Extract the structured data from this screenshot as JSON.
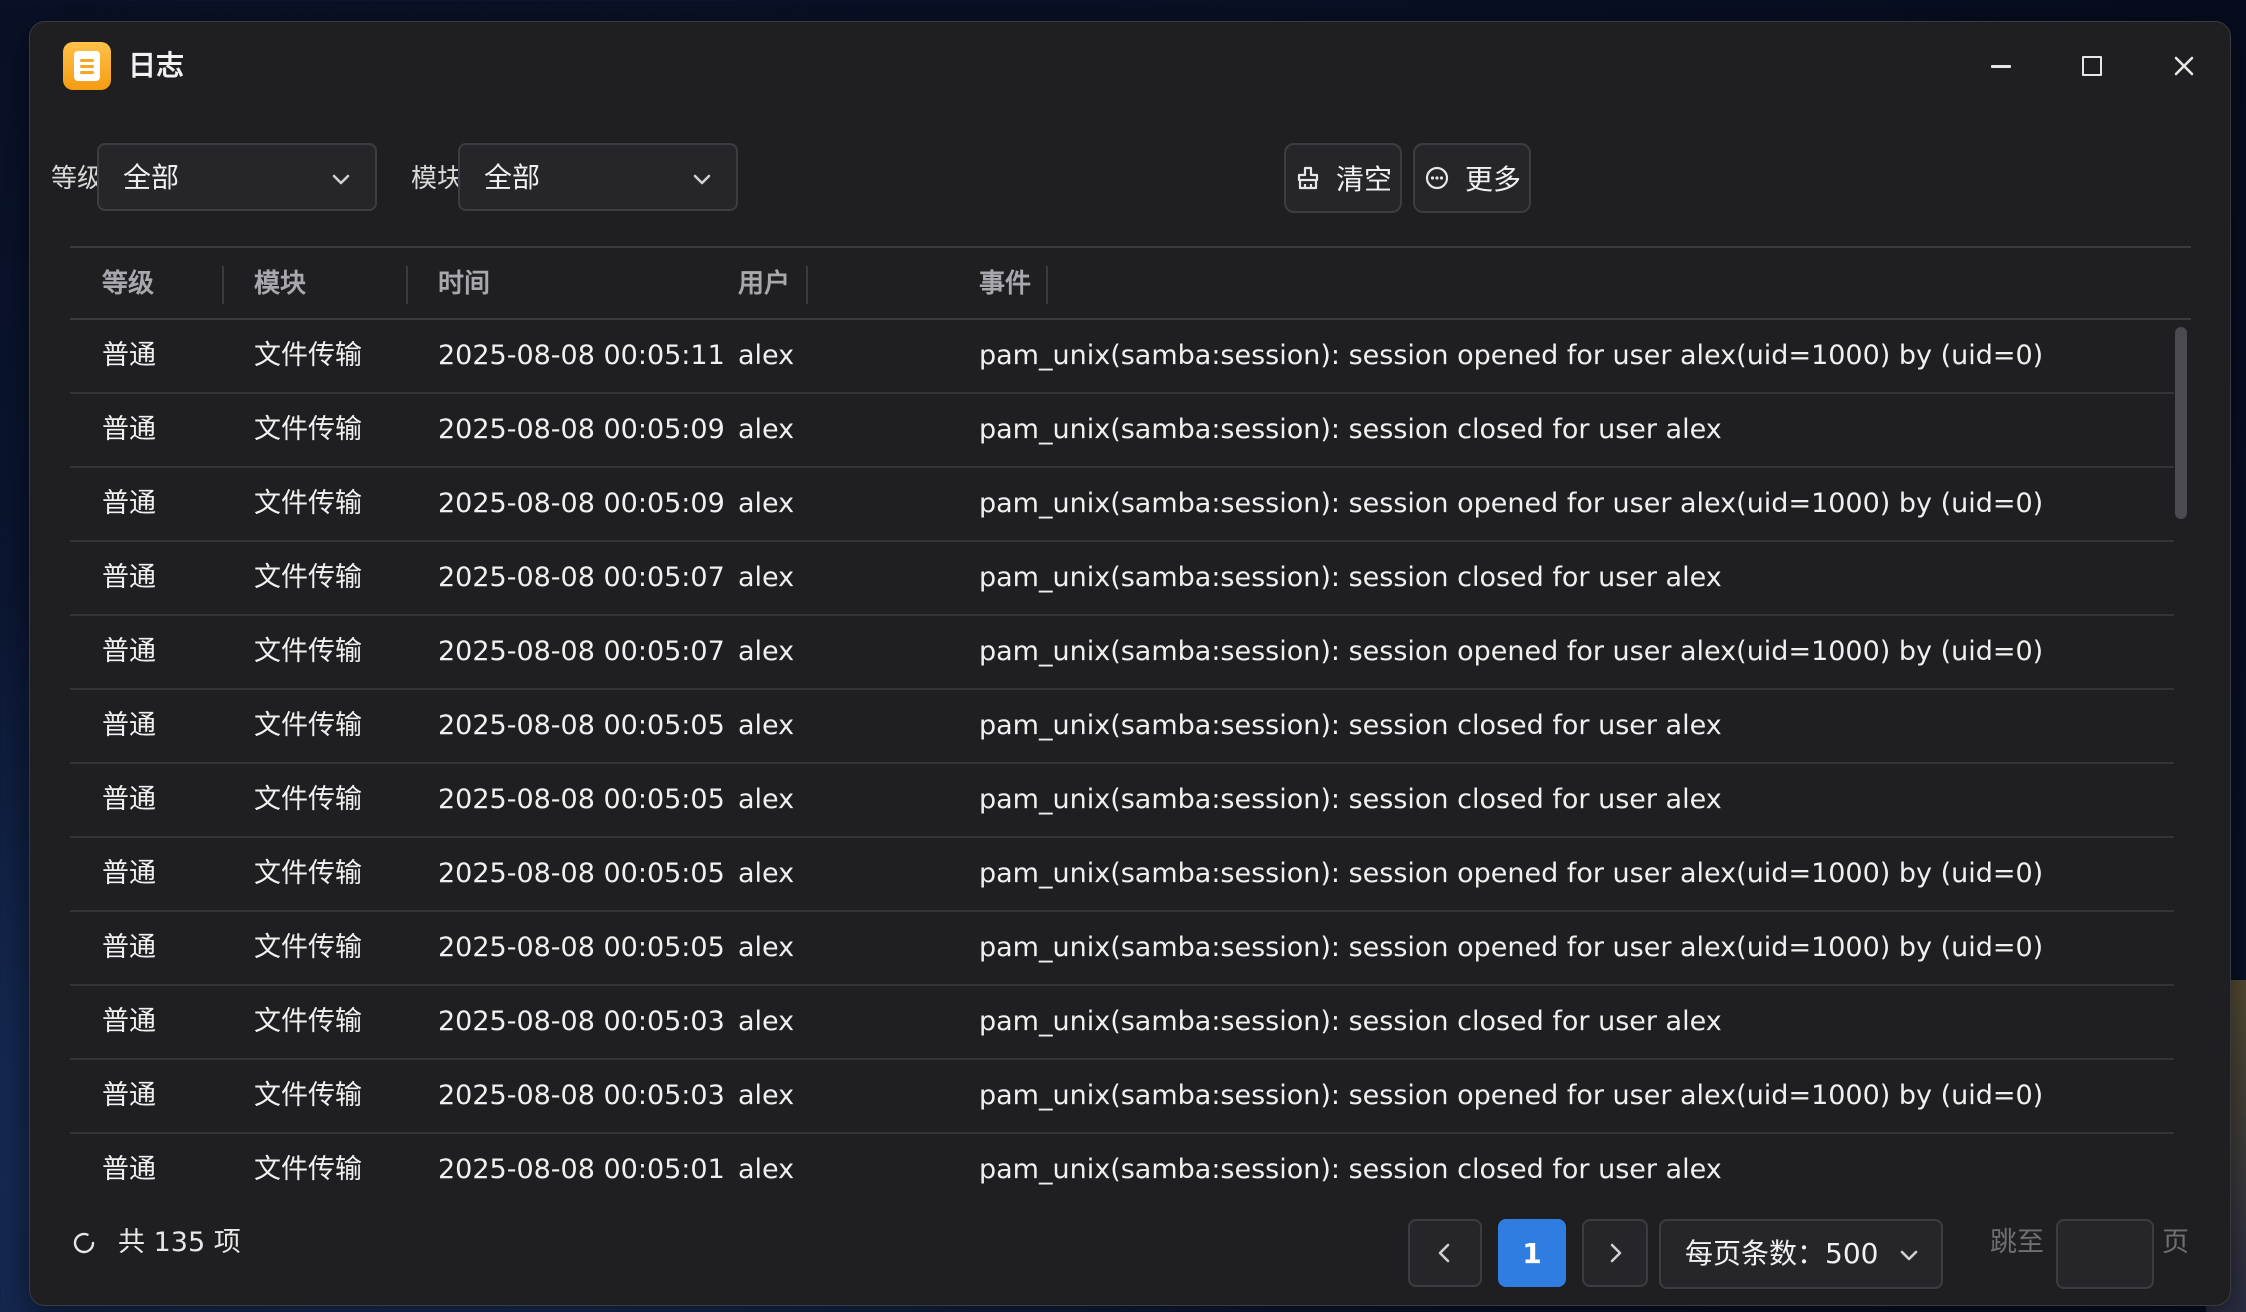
{
  "window": {
    "title": "日志",
    "app_icon": "log-app-icon",
    "controls": [
      "minimize-icon",
      "maximize-icon",
      "close-icon"
    ]
  },
  "filters": {
    "level_label": "等级",
    "level_value": "全部",
    "module_label": "模块",
    "module_value": "全部"
  },
  "actions": {
    "clear_label": "清空",
    "more_label": "更多"
  },
  "table": {
    "headers": {
      "level": "等级",
      "module": "模块",
      "time": "时间",
      "user": "用户",
      "event": "事件"
    },
    "rows": [
      {
        "level": "普通",
        "module": "文件传输",
        "time": "2025-08-08 00:05:11",
        "user": "alex",
        "event": "pam_unix(samba:session): session opened for user alex(uid=1000) by (uid=0)"
      },
      {
        "level": "普通",
        "module": "文件传输",
        "time": "2025-08-08 00:05:09",
        "user": "alex",
        "event": "pam_unix(samba:session): session closed for user alex"
      },
      {
        "level": "普通",
        "module": "文件传输",
        "time": "2025-08-08 00:05:09",
        "user": "alex",
        "event": "pam_unix(samba:session): session opened for user alex(uid=1000) by (uid=0)"
      },
      {
        "level": "普通",
        "module": "文件传输",
        "time": "2025-08-08 00:05:07",
        "user": "alex",
        "event": "pam_unix(samba:session): session closed for user alex"
      },
      {
        "level": "普通",
        "module": "文件传输",
        "time": "2025-08-08 00:05:07",
        "user": "alex",
        "event": "pam_unix(samba:session): session opened for user alex(uid=1000) by (uid=0)"
      },
      {
        "level": "普通",
        "module": "文件传输",
        "time": "2025-08-08 00:05:05",
        "user": "alex",
        "event": "pam_unix(samba:session): session closed for user alex"
      },
      {
        "level": "普通",
        "module": "文件传输",
        "time": "2025-08-08 00:05:05",
        "user": "alex",
        "event": "pam_unix(samba:session): session closed for user alex"
      },
      {
        "level": "普通",
        "module": "文件传输",
        "time": "2025-08-08 00:05:05",
        "user": "alex",
        "event": "pam_unix(samba:session): session opened for user alex(uid=1000) by (uid=0)"
      },
      {
        "level": "普通",
        "module": "文件传输",
        "time": "2025-08-08 00:05:05",
        "user": "alex",
        "event": "pam_unix(samba:session): session opened for user alex(uid=1000) by (uid=0)"
      },
      {
        "level": "普通",
        "module": "文件传输",
        "time": "2025-08-08 00:05:03",
        "user": "alex",
        "event": "pam_unix(samba:session): session closed for user alex"
      },
      {
        "level": "普通",
        "module": "文件传输",
        "time": "2025-08-08 00:05:03",
        "user": "alex",
        "event": "pam_unix(samba:session): session opened for user alex(uid=1000) by (uid=0)"
      },
      {
        "level": "普通",
        "module": "文件传输",
        "time": "2025-08-08 00:05:01",
        "user": "alex",
        "event": "pam_unix(samba:session): session closed for user alex"
      }
    ]
  },
  "footer": {
    "total_text": "共 135 项",
    "current_page": "1",
    "page_size_text": "每页条数：500",
    "jump_label": "跳至",
    "jump_value": "",
    "page_suffix": "页"
  },
  "colors": {
    "accent": "#2f7de1",
    "window_bg": "#1f1f22",
    "app_icon": "#f5a623"
  }
}
